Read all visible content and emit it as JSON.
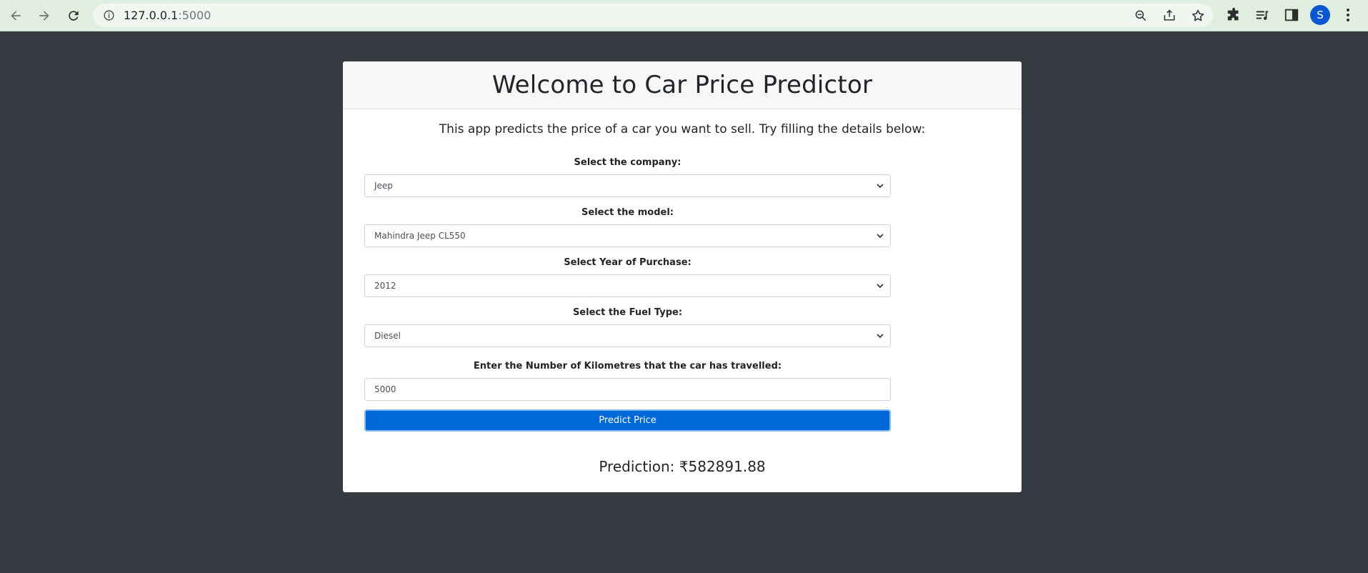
{
  "browser": {
    "url_host": "127.0.0.1",
    "url_port": ":5000",
    "avatar_letter": "S"
  },
  "page": {
    "title": "Welcome to Car Price Predictor",
    "intro": "This app predicts the price of a car you want to sell. Try filling the details below:"
  },
  "form": {
    "company_label": "Select the company:",
    "company_value": "Jeep",
    "model_label": "Select the model:",
    "model_value": "Mahindra Jeep CL550",
    "year_label": "Select Year of Purchase:",
    "year_value": "2012",
    "fuel_label": "Select the Fuel Type:",
    "fuel_value": "Diesel",
    "km_label": "Enter the Number of Kilometres that the car has travelled:",
    "km_value": "5000",
    "submit_label": "Predict Price"
  },
  "result": {
    "prediction_text": "Prediction: ₹582891.88"
  },
  "colors": {
    "page_bg": "#363a41",
    "button_primary": "#0069d9",
    "chrome_bg": "#dfeedf"
  }
}
